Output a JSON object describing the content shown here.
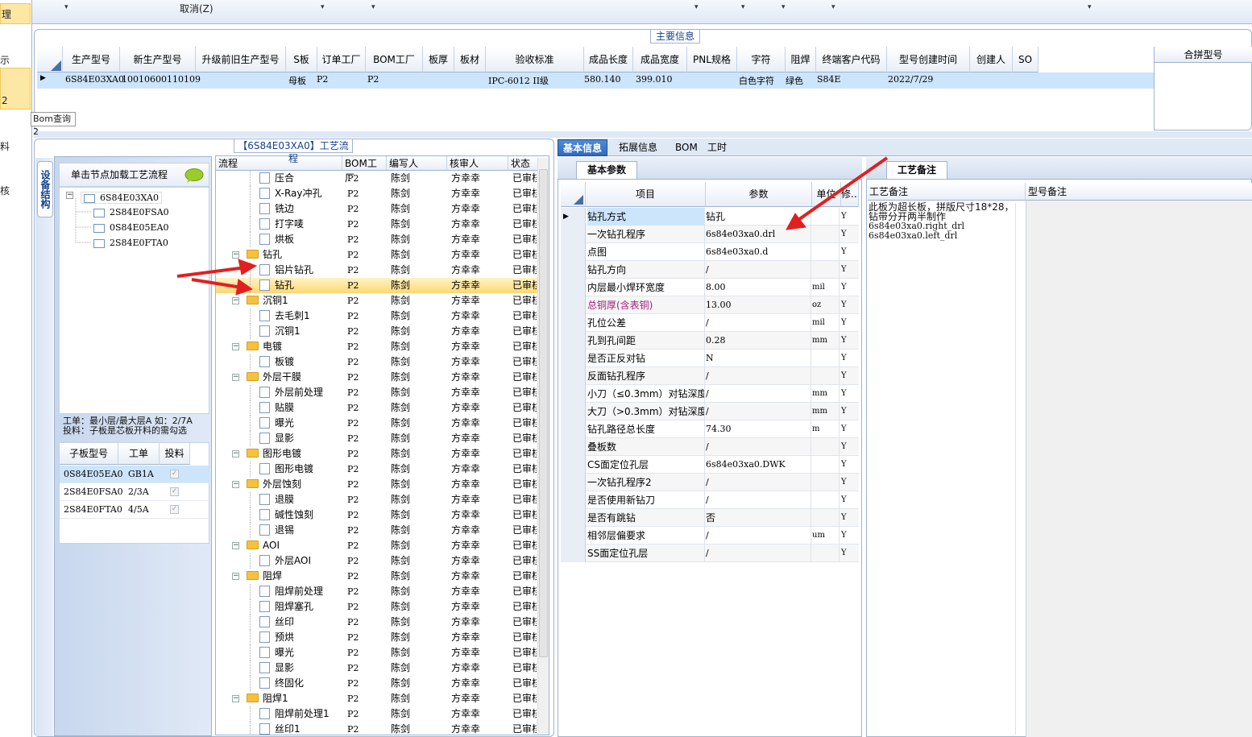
{
  "left_nav": {
    "items": [
      "理",
      "示",
      "2",
      "料",
      "核"
    ],
    "tooltip": "Bom查询2"
  },
  "toolbar": {
    "cancel_label": "取消(Z)"
  },
  "main_info": {
    "legend": "主要信息",
    "columns": [
      "生产型号",
      "新生产型号",
      "升级前旧生产型号",
      "S板",
      "订单工厂",
      "BOM工厂",
      "板厚",
      "板材",
      "验收标准",
      "成品长度",
      "成品宽度",
      "PNL规格",
      "字符",
      "阻焊",
      "终端客户代码",
      "型号创建时间",
      "创建人",
      "SO"
    ],
    "row": {
      "生产型号": "6S84E03XA0",
      "新生产型号": "10010600110109",
      "S板": "母板",
      "订单工厂": "P2",
      "BOM工厂": "P2",
      "验收标准": "IPC-6012 II级",
      "成品长度": "580.140",
      "成品宽度": "399.010",
      "字符": "白色字符",
      "阻焊": "绿色",
      "终端客户代码": "S84E",
      "型号创建时间": "2022/7/29"
    },
    "merge_header": "合拼型号"
  },
  "process_flow": {
    "legend": "【6S84E03XA0】工艺流程",
    "side_tab": "设备结构",
    "tree_head": "单击节点加载工艺流程",
    "tree": {
      "root": "6S84E03XA0",
      "children": [
        "2S84E0FSA0",
        "0S84E05EA0",
        "2S84E0FTA0"
      ]
    },
    "note_line1": "工单：最小层/最大层A 如：2/7A",
    "note_line2": "投料：子板是芯板开料的需勾选",
    "sub_grid": {
      "headers": [
        "子板型号",
        "工单",
        "投料"
      ],
      "rows": [
        {
          "model": "0S84E05EA0",
          "order": "GB1A"
        },
        {
          "model": "2S84E0FSA0",
          "order": "2/3A"
        },
        {
          "model": "2S84E0FTA0",
          "order": "4/5A"
        }
      ]
    },
    "flow_headers": [
      "流程",
      "BOM工厂",
      "编写人",
      "核审人",
      "状态"
    ],
    "flow_rows": [
      {
        "name": "压合",
        "level": 2,
        "folder": false
      },
      {
        "name": "X-Ray冲孔",
        "level": 2,
        "folder": false
      },
      {
        "name": "铣边",
        "level": 2,
        "folder": false
      },
      {
        "name": "打字唛",
        "level": 2,
        "folder": false
      },
      {
        "name": "烘板",
        "level": 2,
        "folder": false
      },
      {
        "name": "钻孔",
        "level": 1,
        "folder": true
      },
      {
        "name": "铝片钻孔",
        "level": 2,
        "folder": false
      },
      {
        "name": "钻孔",
        "level": 2,
        "folder": false,
        "selected": true
      },
      {
        "name": "沉铜1",
        "level": 1,
        "folder": true
      },
      {
        "name": "去毛刺1",
        "level": 2,
        "folder": false
      },
      {
        "name": "沉铜1",
        "level": 2,
        "folder": false
      },
      {
        "name": "电镀",
        "level": 1,
        "folder": true
      },
      {
        "name": "板镀",
        "level": 2,
        "folder": false
      },
      {
        "name": "外层干膜",
        "level": 1,
        "folder": true
      },
      {
        "name": "外层前处理",
        "level": 2,
        "folder": false
      },
      {
        "name": "贴膜",
        "level": 2,
        "folder": false
      },
      {
        "name": "曝光",
        "level": 2,
        "folder": false
      },
      {
        "name": "显影",
        "level": 2,
        "folder": false
      },
      {
        "name": "图形电镀",
        "level": 1,
        "folder": true
      },
      {
        "name": "图形电镀",
        "level": 2,
        "folder": false
      },
      {
        "name": "外层蚀刻",
        "level": 1,
        "folder": true
      },
      {
        "name": "退膜",
        "level": 2,
        "folder": false
      },
      {
        "name": "碱性蚀刻",
        "level": 2,
        "folder": false
      },
      {
        "name": "退锡",
        "level": 2,
        "folder": false
      },
      {
        "name": "AOI",
        "level": 1,
        "folder": true
      },
      {
        "name": "外层AOI",
        "level": 2,
        "folder": false
      },
      {
        "name": "阻焊",
        "level": 1,
        "folder": true
      },
      {
        "name": "阻焊前处理",
        "level": 2,
        "folder": false
      },
      {
        "name": "阻焊塞孔",
        "level": 2,
        "folder": false
      },
      {
        "name": "丝印",
        "level": 2,
        "folder": false
      },
      {
        "name": "预烘",
        "level": 2,
        "folder": false
      },
      {
        "name": "曝光",
        "level": 2,
        "folder": false
      },
      {
        "name": "显影",
        "level": 2,
        "folder": false
      },
      {
        "name": "终固化",
        "level": 2,
        "folder": false
      },
      {
        "name": "阻焊1",
        "level": 1,
        "folder": true
      },
      {
        "name": "阻焊前处理1",
        "level": 2,
        "folder": false
      },
      {
        "name": "丝印1",
        "level": 2,
        "folder": false
      }
    ],
    "row_values": {
      "bom": "P2",
      "writer": "陈剑",
      "reviewer": "方幸幸",
      "status": "已审核"
    }
  },
  "right_tabs": [
    "基本信息",
    "拓展信息",
    "BOM",
    "工时"
  ],
  "basic_params": {
    "tab": "基本参数",
    "headers": [
      "项目",
      "参数",
      "单位",
      "修..."
    ],
    "rows": [
      {
        "item": "钻孔方式",
        "value": "钻孔",
        "unit": "",
        "flag": "Y"
      },
      {
        "item": "一次钻孔程序",
        "value": "6s84e03xa0.drl",
        "unit": "",
        "flag": "Y"
      },
      {
        "item": "点图",
        "value": "6s84e03xa0.d",
        "unit": "",
        "flag": "Y"
      },
      {
        "item": "钻孔方向",
        "value": "/",
        "unit": "",
        "flag": "Y"
      },
      {
        "item": "内层最小焊环宽度",
        "value": "8.00",
        "unit": "mil",
        "flag": "Y"
      },
      {
        "item": "总铜厚(含表铜)",
        "value": "13.00",
        "unit": "oz",
        "flag": "Y",
        "highlight": "#a0207a"
      },
      {
        "item": "孔位公差",
        "value": "/",
        "unit": "mil",
        "flag": "Y"
      },
      {
        "item": "孔到孔间距",
        "value": "0.28",
        "unit": "mm",
        "flag": "Y"
      },
      {
        "item": "是否正反对钻",
        "value": "N",
        "unit": "",
        "flag": "Y"
      },
      {
        "item": "反面钻孔程序",
        "value": "/",
        "unit": "",
        "flag": "Y"
      },
      {
        "item": "小刀（≤0.3mm）对钻深度",
        "value": "/",
        "unit": "mm",
        "flag": "Y"
      },
      {
        "item": "大刀（>0.3mm）对钻深度",
        "value": "/",
        "unit": "mm",
        "flag": "Y"
      },
      {
        "item": "钻孔路径总长度",
        "value": "74.30",
        "unit": "m",
        "flag": "Y"
      },
      {
        "item": "叠板数",
        "value": "/",
        "unit": "",
        "flag": "Y"
      },
      {
        "item": "CS面定位孔层",
        "value": "6s84e03xa0.DWK",
        "unit": "",
        "flag": "Y"
      },
      {
        "item": "一次钻孔程序2",
        "value": "/",
        "unit": "",
        "flag": "Y"
      },
      {
        "item": "是否使用新钻刀",
        "value": "/",
        "unit": "",
        "flag": "Y"
      },
      {
        "item": "是否有跳钻",
        "value": "否",
        "unit": "",
        "flag": "Y"
      },
      {
        "item": "相邻层偏要求",
        "value": "/",
        "unit": "um",
        "flag": "Y"
      },
      {
        "item": "SS面定位孔层",
        "value": "/",
        "unit": "",
        "flag": "Y"
      }
    ]
  },
  "process_notes": {
    "tab": "工艺备注",
    "col1": "工艺备注",
    "col2": "型号备注",
    "lines": [
      "此板为超长板，拼版尺寸18*28，",
      "钻带分开两半制作",
      "6s84e03xa0.right_drl",
      "6s84e03xa0.left_drl"
    ]
  },
  "colors": {
    "accent": "#2f6bc0",
    "selection": "#fcd873",
    "row_select": "#cce5fb",
    "arrow": "#e02020"
  }
}
